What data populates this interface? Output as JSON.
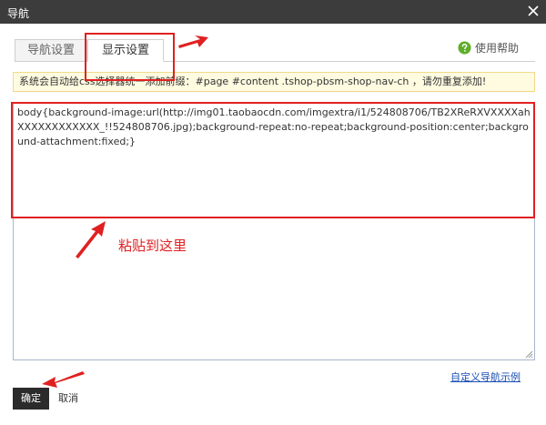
{
  "window": {
    "title": "导航"
  },
  "tabs": [
    {
      "label": "导航设置"
    },
    {
      "label": "显示设置"
    }
  ],
  "help": {
    "label": "使用帮助"
  },
  "notice": {
    "text": "系统会自动给css选择器统一添加前缀：#page #content .tshop-pbsm-shop-nav-ch ，请勿重复添加!"
  },
  "editor": {
    "value": "body{background-image:url(http://img01.taobaocdn.com/imgextra/i1/524808706/TB2XReRXVXXXXahXXXXXXXXXXXX_!!524808706.jpg);background-repeat:no-repeat;background-position:center;background-attachment:fixed;}"
  },
  "annotation": {
    "text": "粘贴到这里"
  },
  "footer": {
    "custom_link": "自定义导航示例",
    "ok_label": "确定",
    "cancel_label": "取消"
  },
  "colors": {
    "titlebar": "#3c3c3c",
    "highlight": "#e02020",
    "help_icon": "#5fae2a",
    "link": "#1a4fb5"
  }
}
